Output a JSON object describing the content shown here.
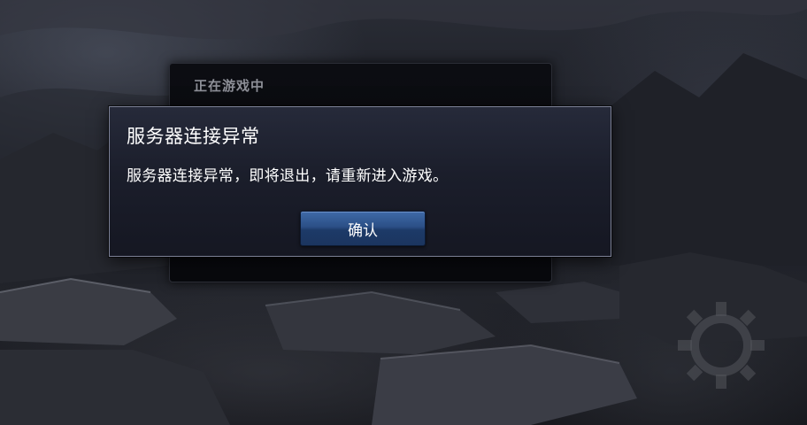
{
  "background_panel": {
    "title": "正在游戏中"
  },
  "dialog": {
    "title": "服务器连接异常",
    "message": "服务器连接异常，即将退出，请重新进入游戏。",
    "confirm_label": "确认"
  },
  "colors": {
    "dialog_border": "#7c8196",
    "dialog_bg": "#1b1e2b",
    "button_blue": "#2b4f86",
    "panel_title": "#8e9098"
  }
}
